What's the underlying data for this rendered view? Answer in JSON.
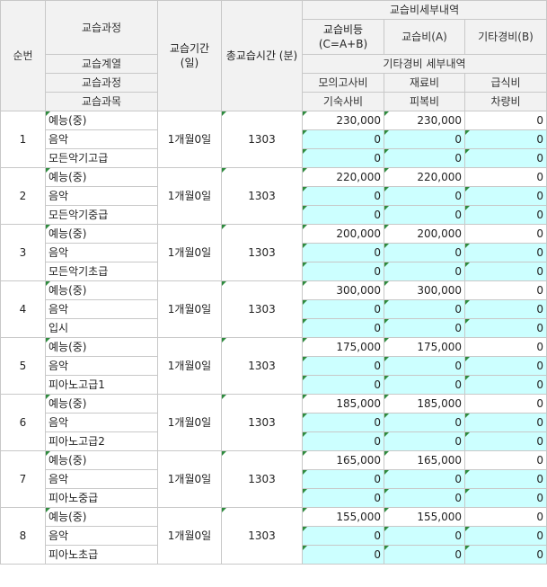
{
  "header": {
    "seq": "순번",
    "course": "교습과정",
    "course_group": "교습계열",
    "course_process": "교습과정",
    "course_subject": "교습과목",
    "period": "교습기간\n(일)",
    "total_time": "총교습시간\n(분)",
    "fee_detail": "교습비세부내역",
    "fee_total": "교습비등\n(C=A+B)",
    "fee_a": "교습비(A)",
    "fee_b": "기타경비(B)",
    "other_detail": "기타경비 세부내역",
    "mock_exam": "모의고사비",
    "materials": "재료비",
    "meals": "급식비",
    "dormitory": "기숙사비",
    "uniform": "피복비",
    "vehicle": "차량비"
  },
  "rows": [
    {
      "seq": "1",
      "group": "예능(중)",
      "process": "음악",
      "subject": "모든악기고급",
      "period": "1개월0일",
      "time": "1303",
      "total": "230,000",
      "fee": "230,000",
      "other": "0",
      "mock": "0",
      "mat": "0",
      "meal": "0",
      "dorm": "0",
      "unif": "0",
      "veh": "0"
    },
    {
      "seq": "2",
      "group": "예능(중)",
      "process": "음악",
      "subject": "모든악기중급",
      "period": "1개월0일",
      "time": "1303",
      "total": "220,000",
      "fee": "220,000",
      "other": "0",
      "mock": "0",
      "mat": "0",
      "meal": "0",
      "dorm": "0",
      "unif": "0",
      "veh": "0"
    },
    {
      "seq": "3",
      "group": "예능(중)",
      "process": "음악",
      "subject": "모든악기초급",
      "period": "1개월0일",
      "time": "1303",
      "total": "200,000",
      "fee": "200,000",
      "other": "0",
      "mock": "0",
      "mat": "0",
      "meal": "0",
      "dorm": "0",
      "unif": "0",
      "veh": "0"
    },
    {
      "seq": "4",
      "group": "예능(중)",
      "process": "음악",
      "subject": "입시",
      "period": "1개월0일",
      "time": "1303",
      "total": "300,000",
      "fee": "300,000",
      "other": "0",
      "mock": "0",
      "mat": "0",
      "meal": "0",
      "dorm": "0",
      "unif": "0",
      "veh": "0"
    },
    {
      "seq": "5",
      "group": "예능(중)",
      "process": "음악",
      "subject": "피아노고급1",
      "period": "1개월0일",
      "time": "1303",
      "total": "175,000",
      "fee": "175,000",
      "other": "0",
      "mock": "0",
      "mat": "0",
      "meal": "0",
      "dorm": "0",
      "unif": "0",
      "veh": "0"
    },
    {
      "seq": "6",
      "group": "예능(중)",
      "process": "음악",
      "subject": "피아노고급2",
      "period": "1개월0일",
      "time": "1303",
      "total": "185,000",
      "fee": "185,000",
      "other": "0",
      "mock": "0",
      "mat": "0",
      "meal": "0",
      "dorm": "0",
      "unif": "0",
      "veh": "0"
    },
    {
      "seq": "7",
      "group": "예능(중)",
      "process": "음악",
      "subject": "피아노중급",
      "period": "1개월0일",
      "time": "1303",
      "total": "165,000",
      "fee": "165,000",
      "other": "0",
      "mock": "0",
      "mat": "0",
      "meal": "0",
      "dorm": "0",
      "unif": "0",
      "veh": "0"
    },
    {
      "seq": "8",
      "group": "예능(중)",
      "process": "음악",
      "subject": "피아노초급",
      "period": "1개월0일",
      "time": "1303",
      "total": "155,000",
      "fee": "155,000",
      "other": "0",
      "mock": "0",
      "mat": "0",
      "meal": "0",
      "dorm": "0",
      "unif": "0",
      "veh": "0"
    }
  ]
}
